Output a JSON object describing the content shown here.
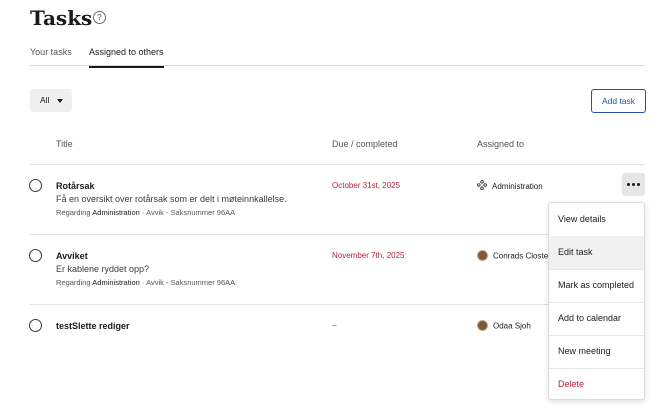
{
  "page": {
    "title": "Tasks",
    "help_icon": "question-circle-icon",
    "help_glyph": "?"
  },
  "tabs": [
    {
      "label": "Your tasks",
      "active": false
    },
    {
      "label": "Assigned to others",
      "active": true
    }
  ],
  "toolbar": {
    "filter_value": "All",
    "add_task_label": "Add task"
  },
  "table": {
    "columns": [
      "Title",
      "Due / completed",
      "Assigned to"
    ],
    "rows": [
      {
        "title": "Rotårsak",
        "description": "Få en oversikt over rotårsak som er delt i møteinnkallelse.",
        "regarding_prefix": "Regarding",
        "regarding_entity": "Administration",
        "regarding_rest": "· Avvik - Saksnummer 96AA",
        "due": "October 31st, 2025",
        "assignee": "Administration",
        "assignee_icon": "group-icon"
      },
      {
        "title": "Avviket",
        "description": "Er kablene ryddet opp?",
        "regarding_prefix": "Regarding",
        "regarding_entity": "Administration",
        "regarding_rest": "· Avvik - Saksnummer 96AA",
        "due": "November 7th, 2025",
        "assignee": "Conrads Closter",
        "assignee_icon": "avatar"
      },
      {
        "title": "testSlette rediger",
        "due": "–",
        "assignee": "Odaa Sjoh",
        "assignee_icon": "avatar"
      }
    ]
  },
  "context_menu": {
    "items": [
      "View details",
      "Edit task",
      "Mark as completed",
      "Add to calendar",
      "New meeting",
      "Delete"
    ],
    "hovered": "Edit task",
    "danger": "Delete"
  },
  "colors": {
    "accent_blue": "#2c4fa8",
    "due_red": "#b5223b"
  }
}
